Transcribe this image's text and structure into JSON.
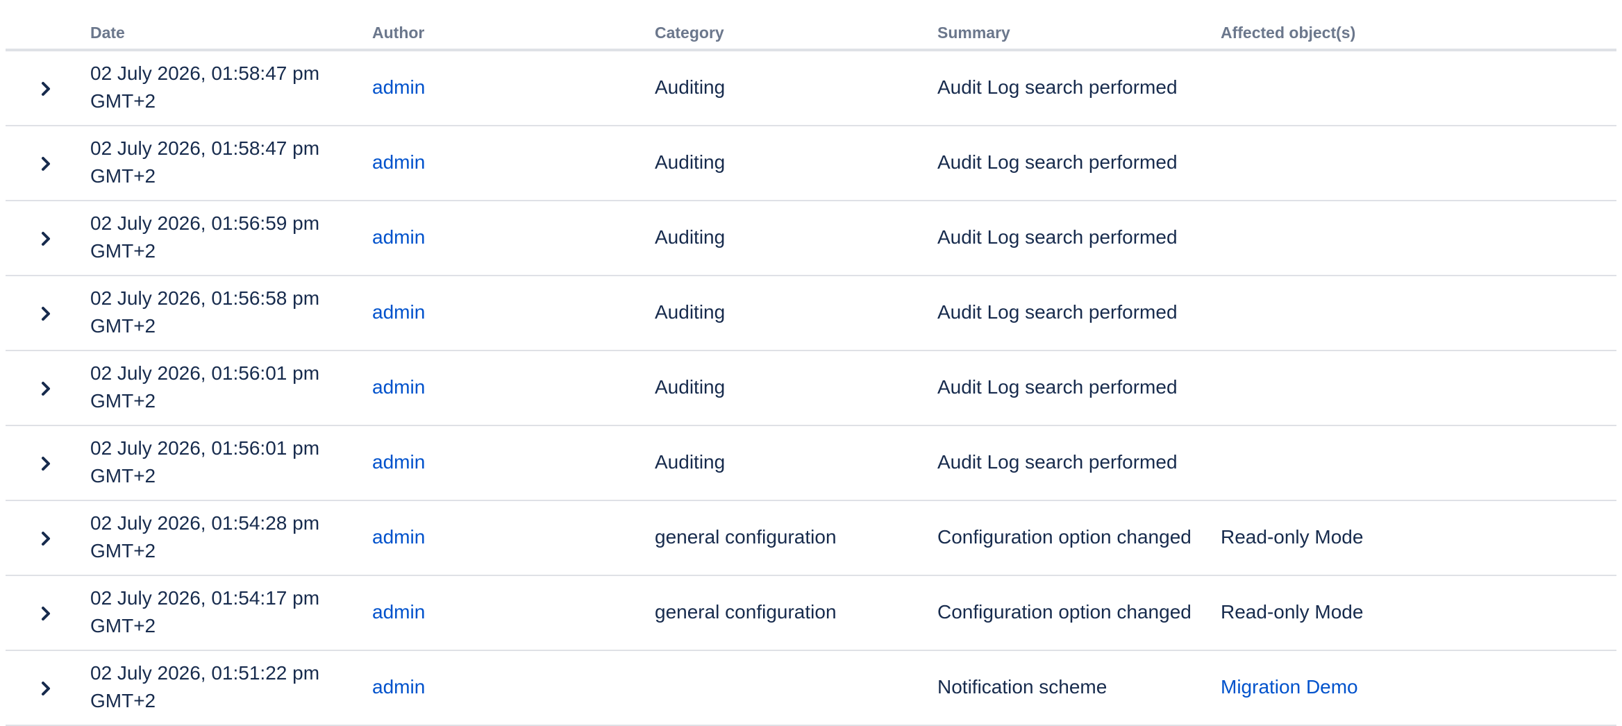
{
  "columns": {
    "date": "Date",
    "author": "Author",
    "category": "Category",
    "summary": "Summary",
    "affected": "Affected object(s)"
  },
  "rows": [
    {
      "date": "02 July 2026, 01:58:47 pm GMT+2",
      "author": "admin",
      "category": "Auditing",
      "summary": "Audit Log search performed",
      "affected": ""
    },
    {
      "date": "02 July 2026, 01:58:47 pm GMT+2",
      "author": "admin",
      "category": "Auditing",
      "summary": "Audit Log search performed",
      "affected": ""
    },
    {
      "date": "02 July 2026, 01:56:59 pm GMT+2",
      "author": "admin",
      "category": "Auditing",
      "summary": "Audit Log search performed",
      "affected": ""
    },
    {
      "date": "02 July 2026, 01:56:58 pm GMT+2",
      "author": "admin",
      "category": "Auditing",
      "summary": "Audit Log search performed",
      "affected": ""
    },
    {
      "date": "02 July 2026, 01:56:01 pm GMT+2",
      "author": "admin",
      "category": "Auditing",
      "summary": "Audit Log search performed",
      "affected": ""
    },
    {
      "date": "02 July 2026, 01:56:01 pm GMT+2",
      "author": "admin",
      "category": "Auditing",
      "summary": "Audit Log search performed",
      "affected": ""
    },
    {
      "date": "02 July 2026, 01:54:28 pm GMT+2",
      "author": "admin",
      "category": "general configuration",
      "summary": "Configuration option changed",
      "affected": "Read-only Mode"
    },
    {
      "date": "02 July 2026, 01:54:17 pm GMT+2",
      "author": "admin",
      "category": "general configuration",
      "summary": "Configuration option changed",
      "affected": "Read-only Mode"
    },
    {
      "date": "02 July 2026, 01:51:22 pm GMT+2",
      "author": "admin",
      "category": "",
      "summary": "Notification scheme",
      "affected": "Migration Demo"
    }
  ],
  "icons": {
    "expand": "chevron-right-icon"
  },
  "colors": {
    "text": "#172b4d",
    "header_text": "#6b778c",
    "link": "#0052cc",
    "divider": "#dfe1e6"
  }
}
